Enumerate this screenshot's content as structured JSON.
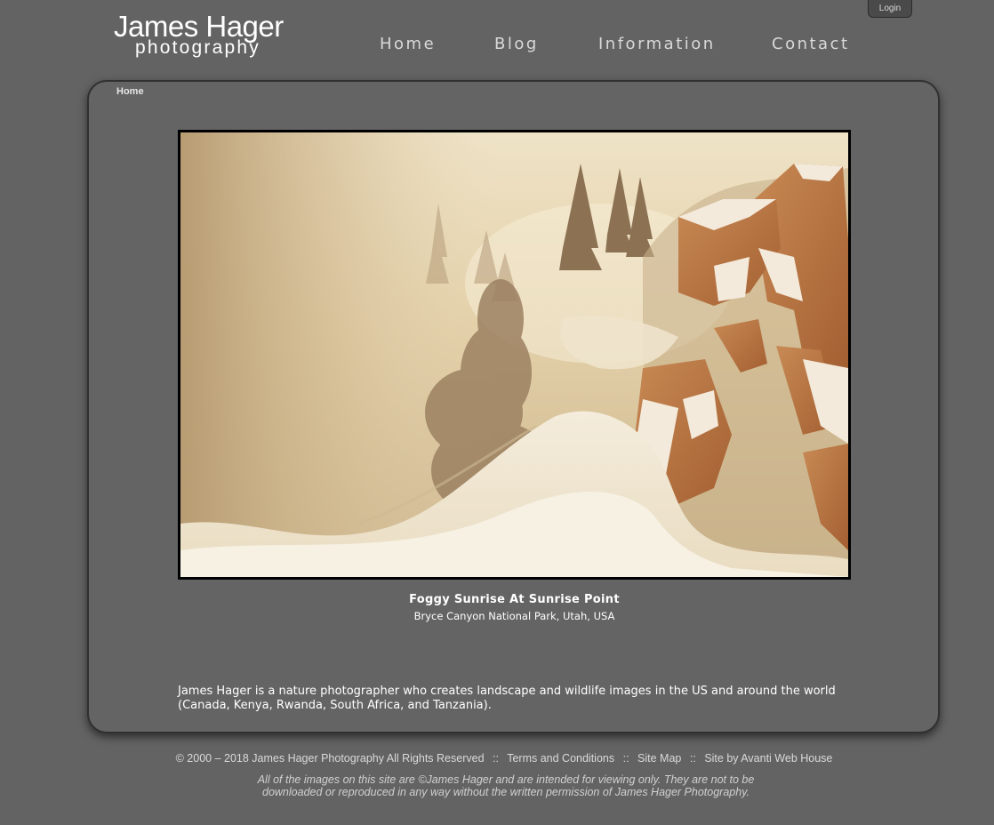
{
  "header": {
    "logo": {
      "line1": "James Hager",
      "line2": "photography"
    },
    "login_label": "Login",
    "nav": [
      "Home",
      "Blog",
      "Information",
      "Contact"
    ]
  },
  "breadcrumb": "Home",
  "featured_photo": {
    "title": "Foggy Sunrise At Sunrise Point",
    "location": "Bryce Canyon National Park, Utah, USA"
  },
  "bio": "James Hager is a nature photographer who creates landscape and wildlife images in the US and around the world (Canada, Kenya, Rwanda, South Africa, and Tanzania).",
  "footer": {
    "copyright": "© 2000 – 2018 James Hager Photography All Rights Reserved",
    "links": [
      "Terms and Conditions",
      "Site Map",
      "Site by Avanti Web House"
    ],
    "separator": "::",
    "disclaimer_line1": "All of the images on this site are ©James Hager and are intended for viewing only. They are not to be",
    "disclaimer_line2": "downloaded or reproduced in any way without the written permission of James Hager Photography."
  }
}
